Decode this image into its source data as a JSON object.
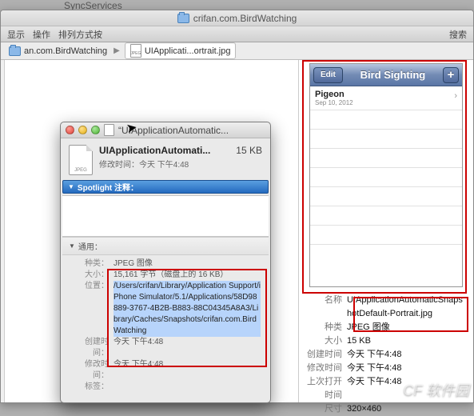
{
  "truncated_app_text": "SyncServices",
  "finder": {
    "title": "crifan.com.BirdWatching",
    "toolbar": {
      "show": "显示",
      "actions": "操作",
      "arrange": "排列方式按",
      "search": "搜索"
    },
    "path": {
      "crumb1": "an.com.BirdWatching",
      "crumb2": "UIApplicati...ortrait.jpg"
    }
  },
  "preview": {
    "phone": {
      "edit": "Edit",
      "title": "Bird Sighting",
      "plus": "+",
      "row_title": "Pigeon",
      "row_sub": "Sep 10, 2012"
    },
    "meta": {
      "name_k": "名称",
      "name_v": "UIApplicationAutomaticSnapshotDefault-Portrait.jpg",
      "kind_k": "种类",
      "kind_v": "JPEG 图像",
      "size_k": "大小",
      "size_v": "15 KB",
      "created_k": "创建时间",
      "created_v": "今天 下午4:48",
      "modified_k": "修改时间",
      "modified_v": "今天 下午4:48",
      "opened_k": "上次打开时间",
      "opened_v": "今天 下午4:48",
      "dims_k": "尺寸",
      "dims_v": "320×460"
    }
  },
  "info": {
    "window_title": "“UIApplicationAutomatic...",
    "filename": "UIApplicationAutomati...",
    "size": "15 KB",
    "modified_label": "修改时间：",
    "modified_value": "今天 下午4:48",
    "icon_badge": "JPEG",
    "spotlight": "Spotlight 注释：",
    "general": "通用：",
    "kind_k": "种类：",
    "kind_v": "JPEG 图像",
    "sizefull_k": "大小：",
    "sizefull_v": "15,161 字节（磁盘上的 16 KB）",
    "where_k": "位置：",
    "where_v": "/Users/crifan/Library/Application Support/iPhone Simulator/5.1/Applications/58D98889-3767-4B2B-B883-88C04345A8A3/Library/Caches/Snapshots/crifan.com.BirdWatching",
    "created_k": "创建时间：",
    "created_v": "今天 下午4:48",
    "modified2_k": "修改时间：",
    "modified2_v": "今天 下午4:48",
    "label_k": "标签："
  }
}
